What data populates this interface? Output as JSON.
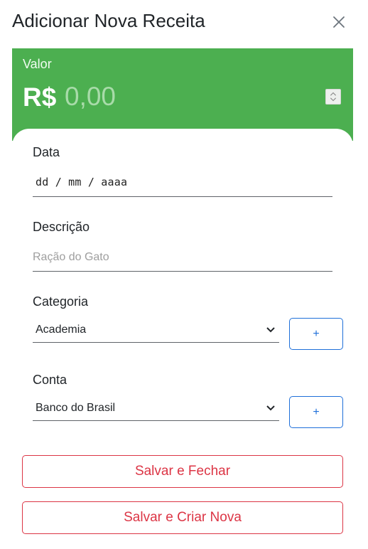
{
  "dialog": {
    "title": "Adicionar Nova Receita",
    "close_icon": "close-icon"
  },
  "value": {
    "label": "Valor",
    "currency": "R$",
    "placeholder": "0,00",
    "spinner_icon": "spinner-arrows-icon",
    "panel_color": "#4caf50"
  },
  "date": {
    "label": "Data",
    "placeholder": "dd / mm / aaaa"
  },
  "description": {
    "label": "Descrição",
    "placeholder": "Ração do Gato"
  },
  "category": {
    "label": "Categoria",
    "selected": "Academia",
    "add_label": "+"
  },
  "account": {
    "label": "Conta",
    "selected": "Banco do Brasil",
    "add_label": "+"
  },
  "actions": {
    "save_close": "Salvar e Fechar",
    "save_new": "Salvar e Criar Nova"
  },
  "colors": {
    "primary": "#1e6fd9",
    "danger": "#dc3545",
    "success": "#4caf50"
  }
}
